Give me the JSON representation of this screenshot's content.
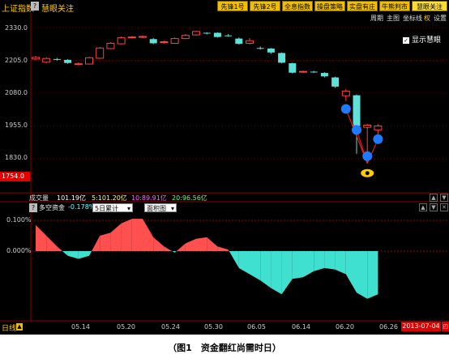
{
  "header": {
    "title": "上证指数",
    "subtitle": "慧眼关注",
    "buttons": [
      "先锋1号",
      "先锋2号",
      "全息指数",
      "操盘策略",
      "实盘有庄",
      "牛熊判市",
      "慧眼关注"
    ]
  },
  "controls": [
    "周期",
    "主图",
    "坐标线",
    "权",
    "设置"
  ],
  "show_huiyan": {
    "checked": true,
    "label": "显示慧眼"
  },
  "price_axis": [
    "2330.0",
    "2205.0",
    "2080.0",
    "1955.0",
    "1830.0"
  ],
  "current_price": "1754.0",
  "volume": {
    "label": "成交量",
    "v1": "101.19亿",
    "v2": "5:101.20亿",
    "v3": "10:89.91亿",
    "v4": "20:96.56亿"
  },
  "indicator": {
    "name": "多空资金",
    "value": "-0.178%",
    "select1": "5日累计",
    "select2": "面积图"
  },
  "indicator_axis": [
    "0.100%",
    "0.000%",
    "-0.100%"
  ],
  "period": "日线",
  "date_axis": [
    "05.14",
    "05.20",
    "05.24",
    "05.30",
    "06.05",
    "06.14",
    "06.20",
    "06.26"
  ],
  "current_date": "2013-07-04",
  "caption": "（图1　资金翻红尚需时日）",
  "chart_data": [
    {
      "type": "candlestick",
      "title": "上证指数",
      "ylim": [
        1754,
        2350
      ],
      "y_ticks": [
        2330,
        2205,
        2080,
        1955,
        1830
      ],
      "x_ticks": [
        "05.14",
        "05.20",
        "05.24",
        "05.30",
        "06.05",
        "06.14",
        "06.20",
        "06.26"
      ],
      "candles": [
        {
          "o": 2210,
          "c": 2216,
          "h": 2222,
          "l": 2205
        },
        {
          "o": 2198,
          "c": 2212,
          "h": 2217,
          "l": 2194
        },
        {
          "o": 2210,
          "c": 2208,
          "h": 2214,
          "l": 2204
        },
        {
          "o": 2207,
          "c": 2195,
          "h": 2210,
          "l": 2192
        },
        {
          "o": 2190,
          "c": 2192,
          "h": 2197,
          "l": 2186
        },
        {
          "o": 2191,
          "c": 2215,
          "h": 2218,
          "l": 2189
        },
        {
          "o": 2213,
          "c": 2252,
          "h": 2256,
          "l": 2211
        },
        {
          "o": 2250,
          "c": 2270,
          "h": 2274,
          "l": 2248
        },
        {
          "o": 2268,
          "c": 2291,
          "h": 2296,
          "l": 2266
        },
        {
          "o": 2292,
          "c": 2294,
          "h": 2298,
          "l": 2288
        },
        {
          "o": 2295,
          "c": 2296,
          "h": 2300,
          "l": 2290
        },
        {
          "o": 2286,
          "c": 2270,
          "h": 2290,
          "l": 2267
        },
        {
          "o": 2273,
          "c": 2276,
          "h": 2280,
          "l": 2270
        },
        {
          "o": 2270,
          "c": 2288,
          "h": 2292,
          "l": 2268
        },
        {
          "o": 2288,
          "c": 2300,
          "h": 2305,
          "l": 2286
        },
        {
          "o": 2302,
          "c": 2315,
          "h": 2318,
          "l": 2298
        },
        {
          "o": 2310,
          "c": 2308,
          "h": 2312,
          "l": 2304
        },
        {
          "o": 2310,
          "c": 2294,
          "h": 2312,
          "l": 2292
        },
        {
          "o": 2300,
          "c": 2298,
          "h": 2305,
          "l": 2295
        },
        {
          "o": 2288,
          "c": 2268,
          "h": 2292,
          "l": 2265
        },
        {
          "o": 2270,
          "c": 2280,
          "h": 2290,
          "l": 2266
        },
        {
          "o": 2252,
          "c": 2250,
          "h": 2258,
          "l": 2246
        },
        {
          "o": 2250,
          "c": 2235,
          "h": 2252,
          "l": 2230
        },
        {
          "o": 2233,
          "c": 2196,
          "h": 2235,
          "l": 2194
        },
        {
          "o": 2194,
          "c": 2158,
          "h": 2196,
          "l": 2155
        },
        {
          "o": 2160,
          "c": 2163,
          "h": 2166,
          "l": 2157
        },
        {
          "o": 2162,
          "c": 2161,
          "h": 2165,
          "l": 2157
        },
        {
          "o": 2157,
          "c": 2144,
          "h": 2160,
          "l": 2140
        },
        {
          "o": 2140,
          "c": 2105,
          "h": 2143,
          "l": 2100
        },
        {
          "o": 2070,
          "c": 2088,
          "h": 2095,
          "l": 2050
        },
        {
          "o": 2072,
          "c": 1955,
          "h": 2075,
          "l": 1849
        },
        {
          "o": 1950,
          "c": 1958,
          "h": 1963,
          "l": 1846
        },
        {
          "o": 1940,
          "c": 1955,
          "h": 1962,
          "l": 1924
        }
      ],
      "markers": [
        {
          "type": "blue-dot",
          "index": 29,
          "value": 2020
        },
        {
          "type": "blue-dot",
          "index": 30,
          "value": 1940
        },
        {
          "type": "blue-dot",
          "index": 31,
          "value": 1840
        },
        {
          "type": "blue-dot",
          "index": 32,
          "value": 1905
        },
        {
          "type": "eye-icon",
          "index": 31,
          "value": 1800
        }
      ]
    },
    {
      "type": "area",
      "title": "多空资金",
      "ylim": [
        -0.175,
        0.12
      ],
      "y_ticks": [
        0.1,
        0.0
      ],
      "values": [
        0.085,
        0.05,
        0.015,
        -0.015,
        -0.025,
        -0.015,
        0.05,
        0.06,
        0.09,
        0.105,
        0.105,
        0.045,
        0.015,
        -0.005,
        0.025,
        0.04,
        0.045,
        0.015,
        0.005,
        -0.055,
        -0.075,
        -0.095,
        -0.12,
        -0.14,
        -0.09,
        -0.085,
        -0.065,
        -0.055,
        -0.06,
        -0.075,
        -0.135,
        -0.155,
        -0.14
      ],
      "positive_color": "#ff5050",
      "negative_color": "#40e0d0"
    }
  ]
}
